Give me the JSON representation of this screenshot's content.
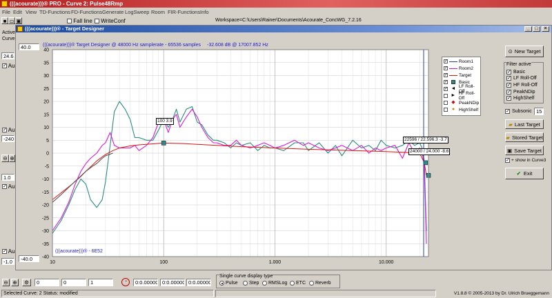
{
  "app": {
    "title": "(((acourate)))® PRO - Curve 2: Pulse48Rmp",
    "menu": [
      "File",
      "Edit",
      "View",
      "TD-Functions",
      "FD-Functions",
      "Generate",
      "LogSweep",
      "Room",
      "FIR-Functions",
      "Info"
    ],
    "toolbar_fall_line": "Fall line",
    "toolbar_write_conf": "WriteConf",
    "workspace": "Workspace=C:\\Users\\Rainer\\Documents\\Acourate_ConcWG_7.2.16"
  },
  "left_panel": {
    "active_label_1": "Active",
    "active_label_2": "Curve",
    "value_1": "24.6",
    "auto_1": "Au",
    "auto_2": "Au",
    "value_2": "-240",
    "value_3": "1.0",
    "auto_3": "Au",
    "value_4": "-1.0",
    "auto_4": "Au",
    "zoom_minus": "−",
    "zoom_plus": "+"
  },
  "dialog": {
    "title": "(((acourate)))® - Target Designer",
    "header_info": "(((acourate)))® Target Designer @ 48000 Hz samplerate - 65536 samples",
    "header_cursor": "-32.608 dB @ 17007.852 Hz",
    "ymax_field": "40.0",
    "ymin_field": "-40.0",
    "watermark": "(((acourate)))® - 6E52"
  },
  "legend": [
    {
      "label": "Room1",
      "checked": true,
      "color": "#2e3a9e",
      "kind": "line"
    },
    {
      "label": "Room2",
      "checked": true,
      "color": "#c020c0",
      "kind": "line"
    },
    {
      "label": "Target",
      "checked": true,
      "color": "#e01010",
      "kind": "line"
    },
    {
      "label": "Basic",
      "checked": true,
      "color": "#2b8a8a",
      "kind": "square"
    },
    {
      "label": "LF Roll-Off",
      "checked": true,
      "color": "#000000",
      "kind": "arrowL"
    },
    {
      "label": "HF Roll-Off",
      "checked": false,
      "color": "#000000",
      "kind": "arrowR"
    },
    {
      "label": "PeakNDip",
      "checked": false,
      "color": "#c01010",
      "kind": "diamond"
    },
    {
      "label": "HighShelf",
      "checked": false,
      "color": "#c09000",
      "kind": "circle"
    }
  ],
  "right_panel": {
    "new_target": "New Target",
    "filter_active": "Filter active",
    "filters": [
      {
        "label": "Basic",
        "checked": true
      },
      {
        "label": "LF Roll-Off",
        "checked": true
      },
      {
        "label": "HF Roll-Off",
        "checked": true
      },
      {
        "label": "PeakNDip",
        "checked": true
      },
      {
        "label": "HighShelf",
        "checked": true
      }
    ],
    "subsonic_label": "Subsonic",
    "subsonic_value": "15",
    "last_target": "Last Target",
    "stored_target": "Stored Target",
    "save_target": "Save Target",
    "show_in_curve3": "+ show in Curve3",
    "exit": "Exit"
  },
  "annotations": {
    "label_100": "100 3.9",
    "label_22596": "22596 / 22.596.3 -3.7",
    "label_24000": "24000 / 24.000 -8.6"
  },
  "chart_data": {
    "type": "line",
    "xscale": "log",
    "xlim": [
      10,
      24000
    ],
    "ylim": [
      -40,
      40
    ],
    "yticks": [
      40,
      35,
      30,
      25,
      20,
      15,
      10,
      5,
      0,
      -5,
      -10,
      -15,
      -20,
      -25,
      -30,
      -35,
      -40
    ],
    "xtick_labels": [
      {
        "value": 10,
        "label": "10"
      },
      {
        "value": 100,
        "label": "100"
      },
      {
        "value": 1000,
        "label": "1.000"
      },
      {
        "value": 10000,
        "label": "10.000"
      }
    ],
    "series": [
      {
        "name": "Room1",
        "color": "#2a8b7f",
        "x": [
          10,
          12,
          14,
          16,
          18,
          20,
          22,
          25,
          28,
          30,
          33,
          36,
          40,
          45,
          50,
          55,
          60,
          70,
          80,
          90,
          100,
          110,
          120,
          130,
          140,
          160,
          180,
          200,
          220,
          250,
          280,
          300,
          350,
          400,
          450,
          500,
          600,
          700,
          800,
          900,
          1000,
          1200,
          1500,
          1800,
          2000,
          2500,
          3000,
          3500,
          4000,
          5000,
          6000,
          7000,
          8000,
          9000,
          10000,
          12000,
          14000,
          16000,
          18000,
          20000,
          21000,
          22000,
          23000
        ],
        "y": [
          -31,
          -26,
          -20,
          -14,
          -10,
          -12,
          -18,
          -21,
          -18,
          -11,
          3,
          16,
          20,
          17,
          13,
          6,
          6,
          5,
          5,
          9,
          13,
          10,
          13,
          17,
          12,
          17,
          18,
          12,
          11,
          7,
          5,
          5,
          4,
          2,
          4,
          3,
          4,
          1,
          3,
          2,
          2,
          1,
          4,
          4,
          1,
          4,
          0,
          3,
          -1,
          5,
          2,
          3,
          1,
          5,
          3,
          2,
          3,
          5,
          3,
          4,
          2,
          -3,
          -30
        ]
      },
      {
        "name": "Room2",
        "color": "#d61bd6",
        "x": [
          10,
          12,
          14,
          16,
          18,
          20,
          22,
          25,
          28,
          30,
          33,
          36,
          40,
          45,
          50,
          55,
          60,
          70,
          80,
          90,
          100,
          110,
          120,
          130,
          140,
          160,
          180,
          200,
          220,
          250,
          280,
          300,
          350,
          400,
          450,
          500,
          600,
          700,
          800,
          900,
          1000,
          1200,
          1500,
          1800,
          2000,
          2500,
          3000,
          3500,
          4000,
          5000,
          6000,
          7000,
          8000,
          9000,
          10000,
          12000,
          14000,
          16000,
          18000,
          20000,
          21000,
          22000,
          23000
        ],
        "y": [
          -30,
          -25,
          -19,
          -12,
          -7,
          -4,
          -2,
          0,
          3,
          4,
          8,
          3,
          2,
          2,
          2,
          3,
          1,
          3,
          6,
          12,
          13,
          8,
          13,
          15,
          10,
          14,
          17,
          14,
          10,
          6,
          4,
          4,
          3,
          3,
          5,
          3,
          2,
          3,
          4,
          3,
          2,
          3,
          5,
          3,
          4,
          2,
          1,
          2,
          3,
          1,
          3,
          0,
          2,
          1,
          2,
          3,
          -2,
          4,
          0,
          2,
          1,
          -5,
          -35
        ]
      },
      {
        "name": "Target",
        "color": "#e01010",
        "x": [
          10,
          15,
          20,
          25,
          30,
          35,
          40,
          50,
          60,
          80,
          100,
          150,
          200,
          300,
          500,
          1000,
          2000,
          5000,
          10000,
          15000,
          20000,
          22000,
          23000
        ],
        "y": [
          -18,
          -12,
          -7,
          -3,
          -0.5,
          1,
          2,
          2.8,
          3.2,
          3.6,
          3.9,
          3.7,
          3.4,
          3.0,
          2.5,
          2.0,
          1.5,
          1.0,
          0.6,
          0.3,
          0.0,
          -3.7,
          -8.6
        ]
      },
      {
        "name": "",
        "color": "#555555",
        "x": [
          10,
          12,
          15,
          18,
          20,
          23,
          25,
          28,
          30,
          35
        ],
        "y": [
          -19,
          -16,
          -12,
          -9,
          -7,
          -5,
          -4,
          -2,
          -1,
          0
        ]
      }
    ],
    "markers": [
      {
        "series": "Basic",
        "x": 100,
        "y": 3.9,
        "shape": "square",
        "color": "#2b8a8a"
      },
      {
        "series": "Basic",
        "x": 22596,
        "y": -3.7,
        "shape": "square",
        "color": "#2b8a8a"
      },
      {
        "series": "Basic",
        "x": 24000,
        "y": -8.6,
        "shape": "square",
        "color": "#2b8a8a"
      }
    ]
  },
  "bottom_toolbar": {
    "fields": [
      "0",
      "0",
      "1"
    ],
    "time_fields": [
      "0:0.00000",
      "0:0.00000",
      "0:0.00000"
    ],
    "display_type_title": "Single curve display type",
    "display_types": [
      {
        "label": "Pulse",
        "on": true
      },
      {
        "label": "Step",
        "on": false
      },
      {
        "label": "RMSLog",
        "on": false
      },
      {
        "label": "ETC",
        "on": false
      },
      {
        "label": "Reverb",
        "on": false
      }
    ]
  },
  "status": {
    "selected_curve": "Selected Curve: 2  Status: modified",
    "version": "V1.8.8 © 2005-2013 by Dr. Ulrich Brueggemann"
  }
}
